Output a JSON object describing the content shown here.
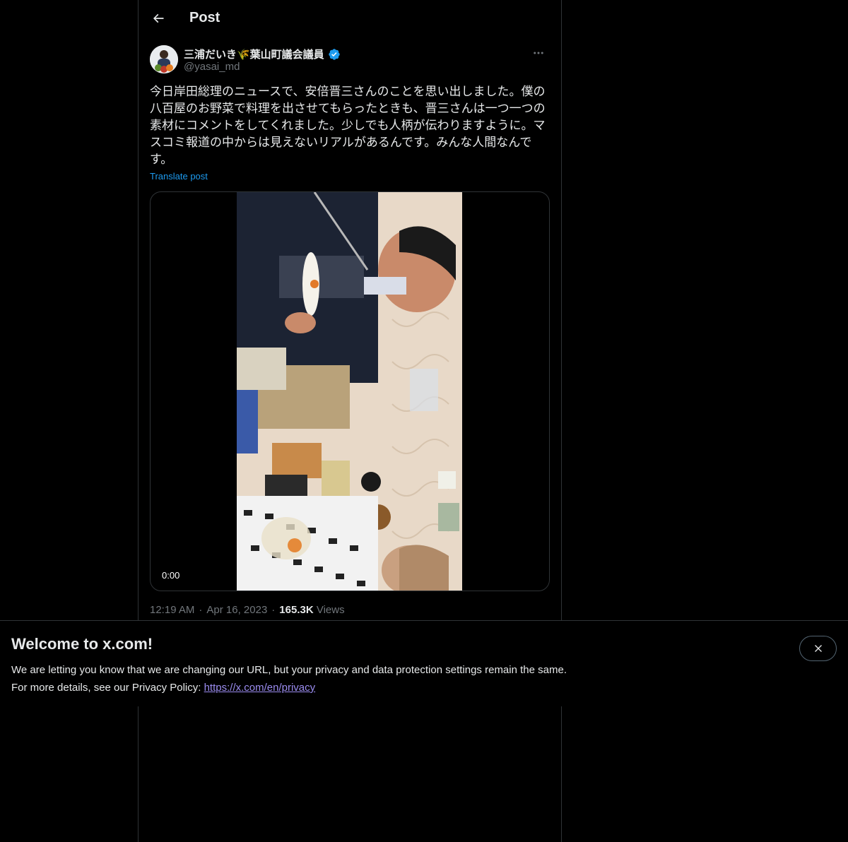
{
  "header": {
    "title": "Post"
  },
  "author": {
    "display_name": "三浦だいき🌾葉山町議会議員",
    "handle": "@yasai_md",
    "verified": true
  },
  "post": {
    "text": "今日岸田総理のニュースで、安倍晋三さんのことを思い出しました。僕の八百屋のお野菜で料理を出させてもらったときも、晋三さんは一つ一つの素材にコメントをしてくれました。少しでも人柄が伝わりますように。マスコミ報道の中からは見えないリアルがあるんです。みんな人間なんです。",
    "translate_label": "Translate post",
    "video_time": "0:00",
    "time": "12:19 AM",
    "date": "Apr 16, 2023",
    "views_count": "165.3K",
    "views_label": "Views"
  },
  "banner": {
    "title": "Welcome to x.com!",
    "line1": "We are letting you know that we are changing our URL, but your privacy and data protection settings remain the same.",
    "line2_prefix": "For more details, see our Privacy Policy: ",
    "link": "https://x.com/en/privacy"
  },
  "colors": {
    "accent": "#1d9bf0",
    "background": "#000000",
    "muted": "#71767b",
    "link_purple": "#9b8cf0"
  },
  "icons": {
    "back": "arrow-left-icon",
    "verified": "verified-badge-icon",
    "more": "more-horizontal-icon",
    "close": "close-icon"
  }
}
